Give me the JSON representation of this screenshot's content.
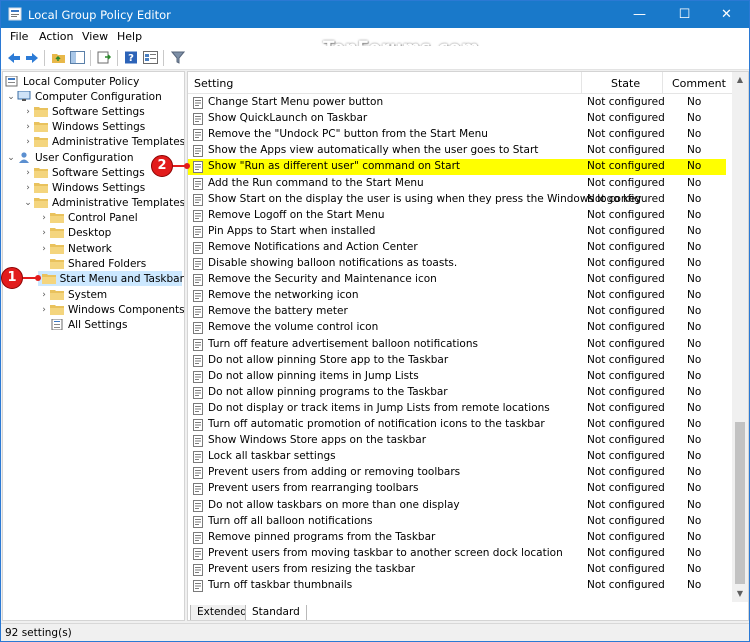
{
  "window": {
    "title": "Local Group Policy Editor",
    "minimize_glyph": "—",
    "maximize_glyph": "☐",
    "close_glyph": "✕"
  },
  "watermark": "TenForums.com",
  "menu": [
    "File",
    "Action",
    "View",
    "Help"
  ],
  "toolbar": {
    "icons": [
      "back-icon",
      "forward-icon",
      "up-folder-icon",
      "show-hide-tree-icon",
      "export-list-icon",
      "help-icon",
      "properties-icon",
      "filter-icon"
    ]
  },
  "tree": {
    "items": [
      {
        "label": "Local Computer Policy",
        "arrow": ""
      },
      {
        "label": "Computer Configuration",
        "arrow": "⌄"
      },
      {
        "label": "Software Settings",
        "arrow": "›"
      },
      {
        "label": "Windows Settings",
        "arrow": "›"
      },
      {
        "label": "Administrative Templates",
        "arrow": "›"
      },
      {
        "label": "User Configuration",
        "arrow": "⌄"
      },
      {
        "label": "Software Settings",
        "arrow": "›"
      },
      {
        "label": "Windows Settings",
        "arrow": "›"
      },
      {
        "label": "Administrative Templates",
        "arrow": "⌄"
      },
      {
        "label": "Control Panel",
        "arrow": "›"
      },
      {
        "label": "Desktop",
        "arrow": "›"
      },
      {
        "label": "Network",
        "arrow": "›"
      },
      {
        "label": "Shared Folders",
        "arrow": ""
      },
      {
        "label": "Start Menu and Taskbar",
        "arrow": "›"
      },
      {
        "label": "System",
        "arrow": "›"
      },
      {
        "label": "Windows Components",
        "arrow": "›"
      },
      {
        "label": "All Settings",
        "arrow": ""
      }
    ]
  },
  "list": {
    "columns": {
      "setting": "Setting",
      "state": "State",
      "comment": "Comment"
    },
    "rows": [
      {
        "name": "Change Start Menu power button",
        "state": "Not configured",
        "comment": "No"
      },
      {
        "name": "Show QuickLaunch on Taskbar",
        "state": "Not configured",
        "comment": "No"
      },
      {
        "name": "Remove the \"Undock PC\" button from the Start Menu",
        "state": "Not configured",
        "comment": "No"
      },
      {
        "name": "Show the Apps view automatically when the user goes to Start",
        "state": "Not configured",
        "comment": "No"
      },
      {
        "name": "Show \"Run as different user\" command on Start",
        "state": "Not configured",
        "comment": "No"
      },
      {
        "name": "Add the Run command to the Start Menu",
        "state": "Not configured",
        "comment": "No"
      },
      {
        "name": "Show Start on the display the user is using when they press the Windows logo key",
        "state": "Not configured",
        "comment": "No"
      },
      {
        "name": "Remove Logoff on the Start Menu",
        "state": "Not configured",
        "comment": "No"
      },
      {
        "name": "Pin Apps to Start when installed",
        "state": "Not configured",
        "comment": "No"
      },
      {
        "name": "Remove Notifications and Action Center",
        "state": "Not configured",
        "comment": "No"
      },
      {
        "name": "Disable showing balloon notifications as toasts.",
        "state": "Not configured",
        "comment": "No"
      },
      {
        "name": "Remove the Security and Maintenance icon",
        "state": "Not configured",
        "comment": "No"
      },
      {
        "name": "Remove the networking icon",
        "state": "Not configured",
        "comment": "No"
      },
      {
        "name": "Remove the battery meter",
        "state": "Not configured",
        "comment": "No"
      },
      {
        "name": "Remove the volume control icon",
        "state": "Not configured",
        "comment": "No"
      },
      {
        "name": "Turn off feature advertisement balloon notifications",
        "state": "Not configured",
        "comment": "No"
      },
      {
        "name": "Do not allow pinning Store app to the Taskbar",
        "state": "Not configured",
        "comment": "No"
      },
      {
        "name": "Do not allow pinning items in Jump Lists",
        "state": "Not configured",
        "comment": "No"
      },
      {
        "name": "Do not allow pinning programs to the Taskbar",
        "state": "Not configured",
        "comment": "No"
      },
      {
        "name": "Do not display or track items in Jump Lists from remote locations",
        "state": "Not configured",
        "comment": "No"
      },
      {
        "name": "Turn off automatic promotion of notification icons to the taskbar",
        "state": "Not configured",
        "comment": "No"
      },
      {
        "name": "Show Windows Store apps on the taskbar",
        "state": "Not configured",
        "comment": "No"
      },
      {
        "name": "Lock all taskbar settings",
        "state": "Not configured",
        "comment": "No"
      },
      {
        "name": "Prevent users from adding or removing toolbars",
        "state": "Not configured",
        "comment": "No"
      },
      {
        "name": "Prevent users from rearranging toolbars",
        "state": "Not configured",
        "comment": "No"
      },
      {
        "name": "Do not allow taskbars on more than one display",
        "state": "Not configured",
        "comment": "No"
      },
      {
        "name": "Turn off all balloon notifications",
        "state": "Not configured",
        "comment": "No"
      },
      {
        "name": "Remove pinned programs from the Taskbar",
        "state": "Not configured",
        "comment": "No"
      },
      {
        "name": "Prevent users from moving taskbar to another screen dock location",
        "state": "Not configured",
        "comment": "No"
      },
      {
        "name": "Prevent users from resizing the taskbar",
        "state": "Not configured",
        "comment": "No"
      },
      {
        "name": "Turn off taskbar thumbnails",
        "state": "Not configured",
        "comment": "No"
      }
    ]
  },
  "tabs": [
    "Extended",
    "Standard"
  ],
  "status": "92 setting(s)",
  "callouts": [
    "1",
    "2"
  ],
  "colors": {
    "titlebar": "#1979ca",
    "highlight": "#ffff00",
    "callout": "#e21c1c",
    "selection": "#cce8ff"
  }
}
